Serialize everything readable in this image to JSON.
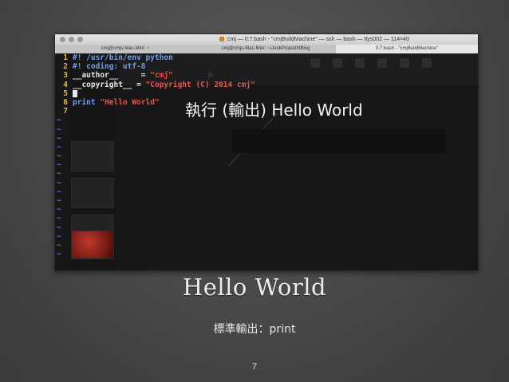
{
  "window": {
    "title": "cmj — 0:7:bash - \"cmjBuildMachine\" — ssh — bash — ttys002 — 114×40",
    "tabs": [
      {
        "label": "cmj@cmjs-Mac-Mini: ~"
      },
      {
        "label": "cmj@cmjs-Mac-Mini: ~/JunkProject/ttBlog"
      },
      {
        "label": "0:7:bash - \"cmjBuildMachine\""
      }
    ]
  },
  "code": {
    "lines": [
      {
        "num": "1",
        "parts": [
          {
            "t": "#! /usr/bin/env python",
            "c": "cm"
          }
        ]
      },
      {
        "num": "2",
        "parts": [
          {
            "t": "#! coding: utf-8",
            "c": "cm"
          }
        ]
      },
      {
        "num": "3",
        "parts": [
          {
            "t": "__author__",
            "c": "pl"
          },
          {
            "t": "     = ",
            "c": "pl"
          },
          {
            "t": "\"cmj\"",
            "c": "st"
          }
        ]
      },
      {
        "num": "4",
        "parts": [
          {
            "t": "__copyright__",
            "c": "pl"
          },
          {
            "t": " = ",
            "c": "pl"
          },
          {
            "t": "\"Copyright (C) 2014 cmj\"",
            "c": "st"
          }
        ]
      },
      {
        "num": "5",
        "parts": []
      },
      {
        "num": "6",
        "parts": [
          {
            "t": "print",
            "c": "kw"
          },
          {
            "t": " ",
            "c": "pl"
          },
          {
            "t": "\"Hello World\"",
            "c": "st"
          }
        ]
      },
      {
        "num": "7",
        "parts": []
      }
    ],
    "tilde": "~",
    "tilde_count": 16
  },
  "annotation": "執行 (輸出) Hello World",
  "slide": {
    "heading": "Hello  World",
    "subtitle": "標準輸出：print",
    "page_number": "7"
  },
  "colors": {
    "background": "#474747",
    "line_number": "#e0b93e",
    "comment": "#6fa0e8",
    "string": "#e0584e",
    "tilde": "#5a6fd6"
  }
}
